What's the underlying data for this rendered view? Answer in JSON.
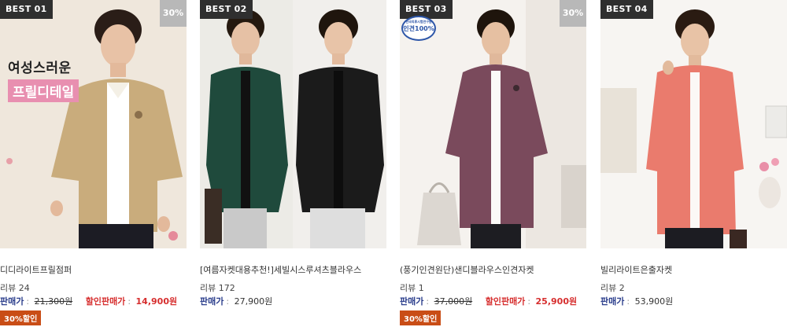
{
  "products": [
    {
      "rank": "BEST 01",
      "discount": "30%",
      "overlay_line1": "여성스러운",
      "overlay_line2": "프릴디테일",
      "name": "디디라이트프릴점퍼",
      "review": "리뷰 24",
      "price_label": "판매가",
      "original_price": "21,300원",
      "sale_label": "할인판매가",
      "sale_price": "14,900원",
      "badge": "30%할인",
      "garment_color": "#c9ac7c"
    },
    {
      "rank": "BEST 02",
      "name": "[여름자켓대용추천!]세빌시스루셔츠블라우스",
      "review": "리뷰 172",
      "price_label": "판매가",
      "price": "27,900원",
      "garment_color": "#1f4a3c",
      "garment_color_2": "#1b1b1b"
    },
    {
      "rank": "BEST 03",
      "discount": "30%",
      "stamp_top": "한국의류시험연구원",
      "stamp_text": "인견100%",
      "name": "(풍기인견원단)샌디블라우스인견자켓",
      "review": "리뷰 1",
      "price_label": "판매가",
      "original_price": "37,000원",
      "sale_label": "할인판매가",
      "sale_price": "25,900원",
      "badge": "30%할인",
      "garment_color": "#7a4a5c"
    },
    {
      "rank": "BEST 04",
      "name": "빌리라이트은출자켓",
      "review": "리뷰 2",
      "price_label": "판매가",
      "price": "53,900원",
      "garment_color": "#ea7b6d"
    }
  ]
}
